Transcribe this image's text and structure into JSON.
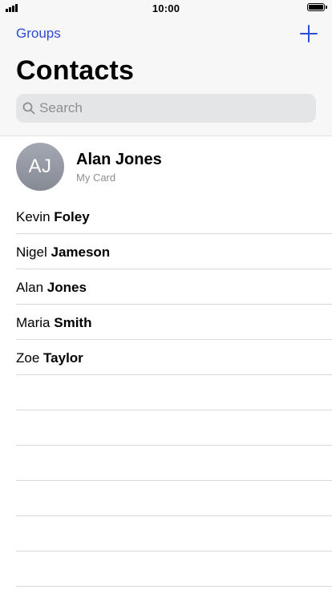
{
  "status_bar": {
    "time": "10:00",
    "signal_icon": "cellular-signal-icon",
    "battery_icon": "battery-icon",
    "battery_level": 1.0
  },
  "nav": {
    "left_button": "Groups",
    "right_icon": "plus-icon",
    "accent_color": "#2c4bd6"
  },
  "title": "Contacts",
  "search": {
    "placeholder": "Search",
    "value": "",
    "icon": "magnifying-glass-icon"
  },
  "my_card": {
    "initials": "AJ",
    "name": "Alan Jones",
    "subtitle": "My Card"
  },
  "contacts": [
    {
      "first": "Kevin",
      "last": "Foley"
    },
    {
      "first": "Nigel",
      "last": "Jameson"
    },
    {
      "first": "Alan",
      "last": "Jones"
    },
    {
      "first": "Maria",
      "last": "Smith"
    },
    {
      "first": "Zoe",
      "last": "Taylor"
    }
  ]
}
